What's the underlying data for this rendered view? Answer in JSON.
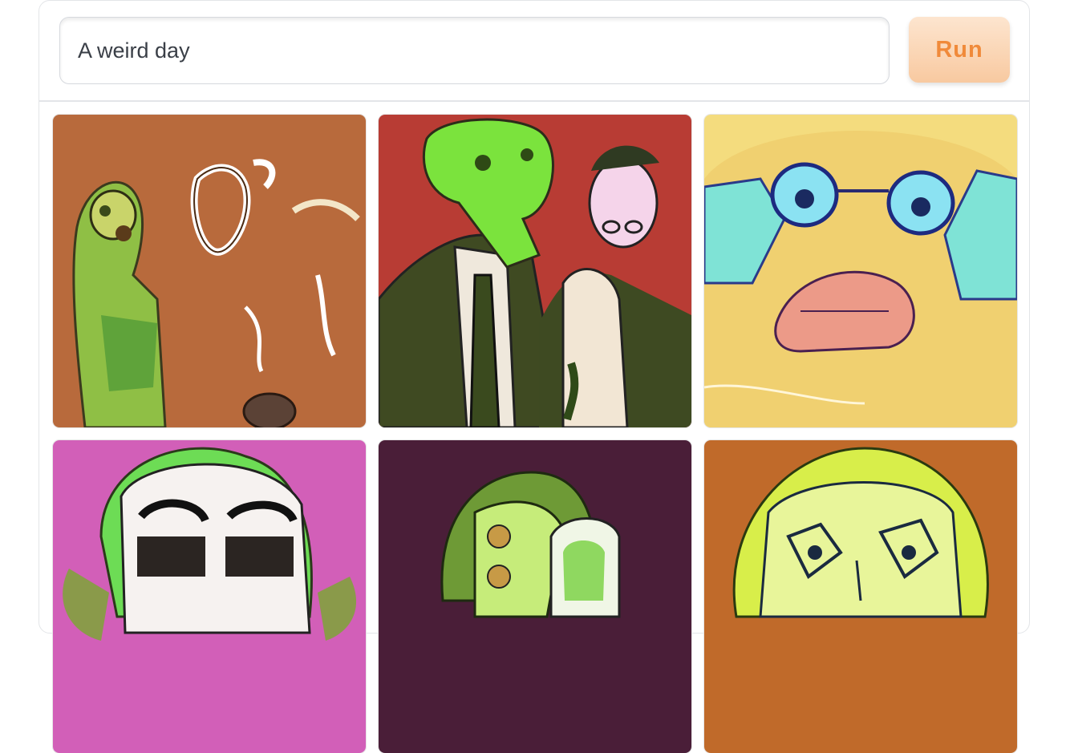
{
  "prompt": {
    "value": "A weird day"
  },
  "run_button": {
    "label": "Run"
  },
  "colors": {
    "accent": "#f08a3a",
    "button_bg": "#fbd9bb",
    "border": "#e3e5e8"
  },
  "gallery": {
    "image_count": 6
  }
}
